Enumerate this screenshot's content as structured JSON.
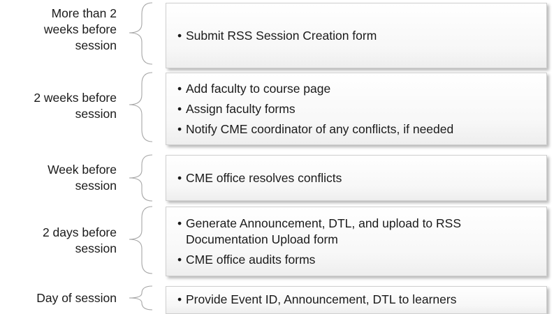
{
  "stages": [
    {
      "label_lines": [
        "More than 2",
        "weeks before",
        "session"
      ],
      "items": [
        "Submit RSS Session Creation form"
      ]
    },
    {
      "label_lines": [
        "2 weeks before",
        "session"
      ],
      "items": [
        "Add faculty to course page",
        "Assign faculty forms",
        "Notify CME coordinator of any conflicts, if needed"
      ]
    },
    {
      "label_lines": [
        "Week before",
        "session"
      ],
      "items": [
        "CME office resolves conflicts"
      ]
    },
    {
      "label_lines": [
        "2 days before",
        "session"
      ],
      "items": [
        "Generate Announcement, DTL, and upload to RSS Documentation Upload form",
        "CME office audits forms"
      ]
    },
    {
      "label_lines": [
        "Day of session"
      ],
      "items": [
        "Provide Event ID, Announcement, DTL to learners"
      ]
    }
  ],
  "colors": {
    "brace": "#a6a6a6",
    "box_border": "#cfcfcf",
    "text": "#1a1a1a"
  },
  "icons": [
    "left-brace-icon"
  ]
}
